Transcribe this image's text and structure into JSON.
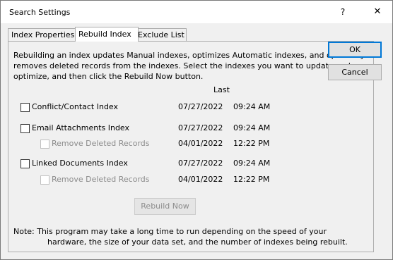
{
  "window": {
    "title": "Search Settings",
    "help_label": "?",
    "close_label": "✕"
  },
  "tabs": [
    {
      "label": "Index Properties",
      "active": false
    },
    {
      "label": "Rebuild Index",
      "active": true
    },
    {
      "label": "Exclude List",
      "active": false
    }
  ],
  "panel": {
    "description": "Rebuilding an index updates Manual indexes, optimizes Automatic indexes, and optionally removes deleted records from the indexes.  Select the indexes you want to update and optimize, and then click the Rebuild Now button.",
    "column_header": "Last",
    "rows": [
      {
        "label": "Conflict/Contact Index",
        "checked": false,
        "enabled": true,
        "date": "07/27/2022",
        "time": "09:24 AM"
      },
      {
        "label": "Email Attachments Index",
        "checked": false,
        "enabled": true,
        "date": "07/27/2022",
        "time": "09:24 AM"
      },
      {
        "label": "Remove Deleted Records",
        "checked": false,
        "enabled": false,
        "date": "04/01/2022",
        "time": "12:22 PM"
      },
      {
        "label": "Linked Documents Index",
        "checked": false,
        "enabled": true,
        "date": "07/27/2022",
        "time": "09:24 AM"
      },
      {
        "label": "Remove Deleted Records",
        "checked": false,
        "enabled": false,
        "date": "04/01/2022",
        "time": "12:22 PM"
      }
    ],
    "rebuild_button": "Rebuild Now",
    "note_line1": "Note: This program may take a long time to run depending on the speed of your",
    "note_line2": "hardware, the size of your data set, and the number of indexes being rebuilt."
  },
  "buttons": {
    "ok": "OK",
    "cancel": "Cancel"
  }
}
